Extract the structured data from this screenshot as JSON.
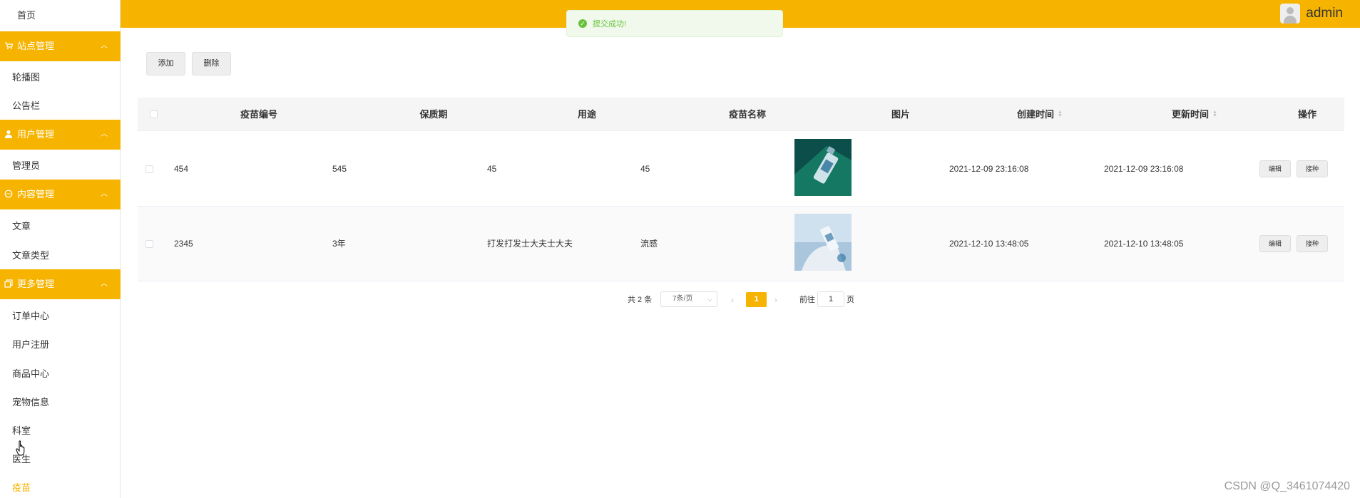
{
  "colors": {
    "accent": "#f6b400",
    "success": "#67c23a"
  },
  "sidebar": {
    "home": "首页",
    "groups": [
      {
        "label": "站点管理",
        "icon": "cart-icon",
        "items": [
          "轮播图",
          "公告栏"
        ]
      },
      {
        "label": "用户管理",
        "icon": "user-icon",
        "items": [
          "管理员"
        ]
      },
      {
        "label": "内容管理",
        "icon": "chat-icon",
        "items": [
          "文章",
          "文章类型"
        ]
      },
      {
        "label": "更多管理",
        "icon": "copy-icon",
        "items": [
          "订单中心",
          "用户注册",
          "商品中心",
          "宠物信息",
          "科室",
          "医生",
          "疫苗"
        ]
      }
    ],
    "active_item": "疫苗"
  },
  "header": {
    "username": "admin"
  },
  "toast": {
    "text": "提交成功!"
  },
  "toolbar": {
    "add_label": "添加",
    "delete_label": "删除"
  },
  "table": {
    "columns": [
      "疫苗编号",
      "保质期",
      "用途",
      "疫苗名称",
      "图片",
      "创建时间",
      "更新时间",
      "操作"
    ],
    "rows": [
      {
        "code": "454",
        "shelf_life": "545",
        "usage": "45",
        "name": "45",
        "created": "2021-12-09 23:16:08",
        "updated": "2021-12-09 23:16:08"
      },
      {
        "code": "2345",
        "shelf_life": "3年",
        "usage": "打发打发士大夫士大夫",
        "name": "流感",
        "created": "2021-12-10 13:48:05",
        "updated": "2021-12-10 13:48:05"
      }
    ],
    "edit_label": "编辑",
    "vaccinate_label": "接种"
  },
  "pagination": {
    "total_text": "共 2 条",
    "page_size": "7条/页",
    "current_page": "1",
    "goto_prefix": "前往",
    "goto_value": "1",
    "goto_suffix": "页"
  },
  "watermark": "CSDN @Q_3461074420"
}
